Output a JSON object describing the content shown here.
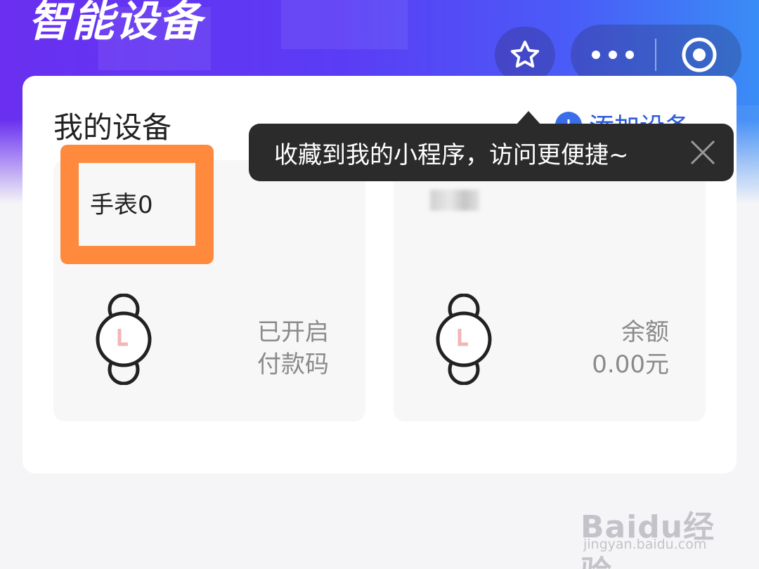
{
  "header": {
    "title": "智能设备",
    "favorite_icon": "star-icon",
    "more_icon": "more-dots-icon",
    "target_icon": "target-icon",
    "gradient_colors": [
      "#6a2ff0",
      "#3a8cf6"
    ]
  },
  "card": {
    "title": "我的设备",
    "add_label": "添加设备",
    "add_icon": "plus-circle-icon"
  },
  "devices": [
    {
      "name": "手表0",
      "status_line1": "已开启",
      "status_line2": "付款码",
      "icon": "watch-icon"
    },
    {
      "name": "",
      "status_line1": "余额",
      "status_line2": "0.00元",
      "icon": "watch-icon"
    }
  ],
  "tooltip": {
    "text": "收藏到我的小程序，访问更便捷~",
    "close_icon": "close-icon"
  },
  "highlight_color": "#ff8a3d",
  "watermark": {
    "main": "Baidu经验",
    "sub": "jingyan.baidu.com"
  }
}
